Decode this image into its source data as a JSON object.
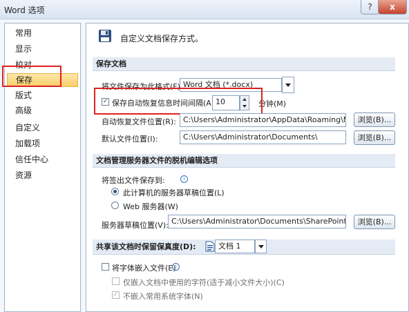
{
  "window": {
    "title": "Word 选项",
    "help": "?",
    "close": "x"
  },
  "sidebar": {
    "items": [
      {
        "label": "常用"
      },
      {
        "label": "显示"
      },
      {
        "label": "校对"
      },
      {
        "label": "保存",
        "selected": true
      },
      {
        "label": "版式"
      },
      {
        "label": "高级"
      },
      {
        "label": "自定义"
      },
      {
        "label": "加载项"
      },
      {
        "label": "信任中心"
      },
      {
        "label": "资源"
      }
    ]
  },
  "header": {
    "description": "自定义文档保存方式。",
    "icon": "floppy-disk-icon"
  },
  "save_section": {
    "title": "保存文档",
    "format_label": "将文件保存为此格式(F):",
    "format_value": "Word 文档 (*.docx)",
    "autorecover_label": "保存自动恢复信息时间间隔(A)",
    "autorecover_checked": true,
    "autorecover_value": "10",
    "minutes_label": "分钟(M)",
    "autorecover_location_label": "自动恢复文件位置(R):",
    "autorecover_location_value": "C:\\Users\\Administrator\\AppData\\Roaming\\Micro",
    "default_location_label": "默认文件位置(I):",
    "default_location_value": "C:\\Users\\Administrator\\Documents\\",
    "browse_label": "浏览(B)..."
  },
  "offline_section": {
    "title": "文档管理服务器文件的脱机编辑选项",
    "checkout_label": "将签出文件保存到:",
    "option_server_drafts": "此计算机的服务器草稿位置(L)",
    "option_web_server": "Web 服务器(W)",
    "drafts_location_label": "服务器草稿位置(V):",
    "drafts_location_value": "C:\\Users\\Administrator\\Documents\\SharePoint 草稿\\",
    "browse_label": "浏览(B)..."
  },
  "fidelity_section": {
    "title": "共享该文档时保留保真度(D):",
    "document_value": "文档 1",
    "embed_fonts_label": "将字体嵌入文件(E)",
    "embed_chars_label": "仅嵌入文档中使用的字符(适于减小文件大小)(C)",
    "no_common_fonts_label": "不嵌入常用系统字体(N)"
  },
  "colors": {
    "highlight": "#e02020",
    "selected_nav": "#f9cf6a"
  }
}
